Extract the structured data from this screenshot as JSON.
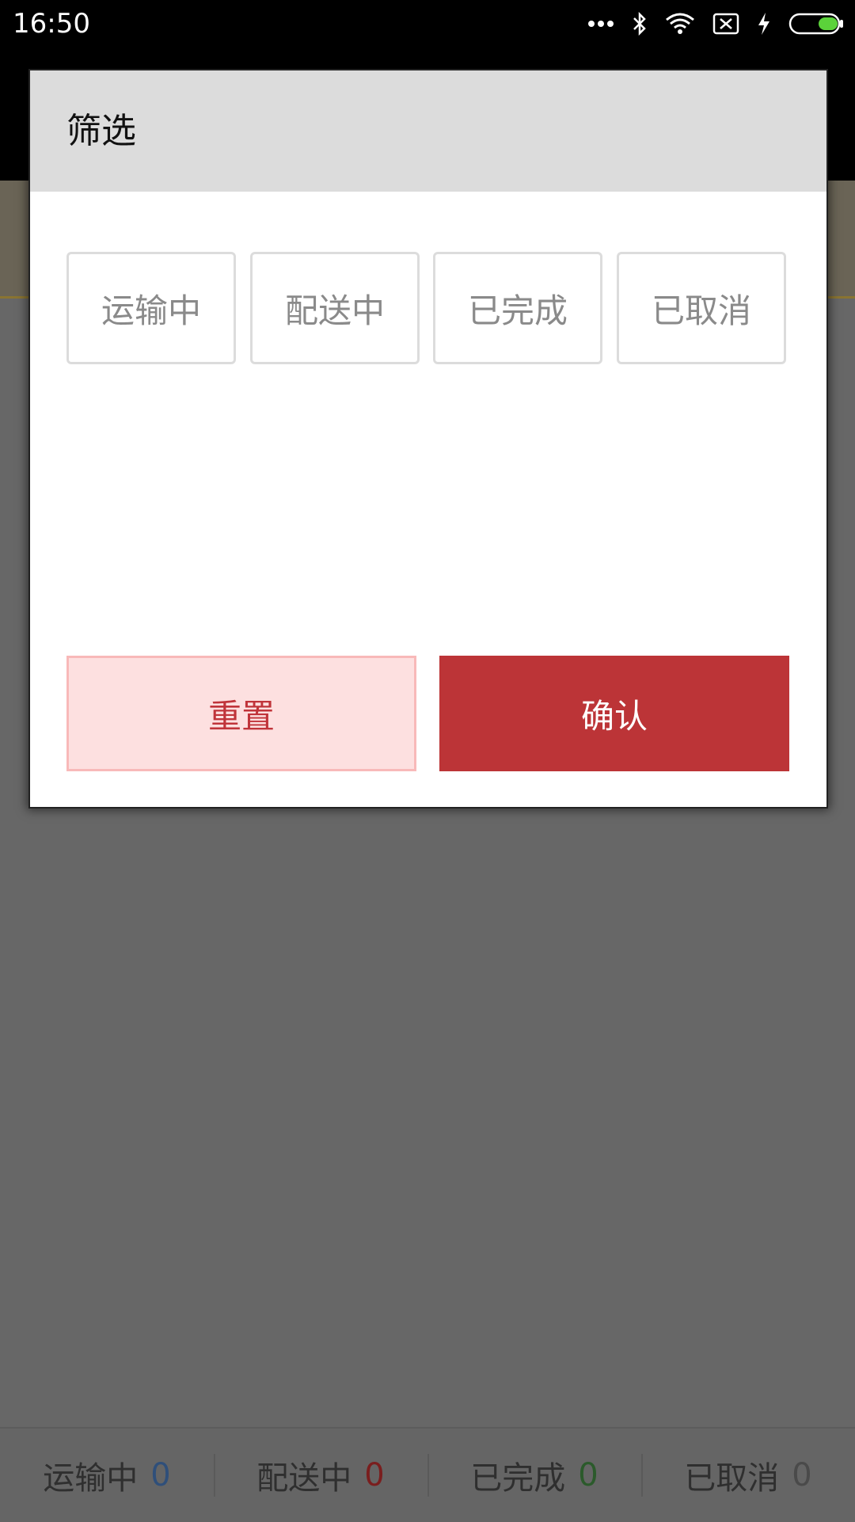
{
  "status_bar": {
    "time": "16:50",
    "icons": [
      "more-dots-icon",
      "bluetooth-icon",
      "wifi-icon",
      "sim-x-icon",
      "charging-icon",
      "battery-icon"
    ]
  },
  "dialog": {
    "title": "筛选",
    "options": [
      {
        "label": "运输中"
      },
      {
        "label": "配送中"
      },
      {
        "label": "已完成"
      },
      {
        "label": "已取消"
      }
    ],
    "reset_label": "重置",
    "confirm_label": "确认"
  },
  "summary": {
    "items": [
      {
        "label": "运输中",
        "count": "0",
        "color": "#2f4f7a"
      },
      {
        "label": "配送中",
        "count": "0",
        "color": "#7a1e1e"
      },
      {
        "label": "已完成",
        "count": "0",
        "color": "#2b5a2b"
      },
      {
        "label": "已取消",
        "count": "0",
        "color": "#4a4a4a"
      }
    ]
  },
  "colors": {
    "accent_red": "#bc3437",
    "reset_bg": "#fde0e0",
    "header_gray": "#dcdcdc"
  }
}
